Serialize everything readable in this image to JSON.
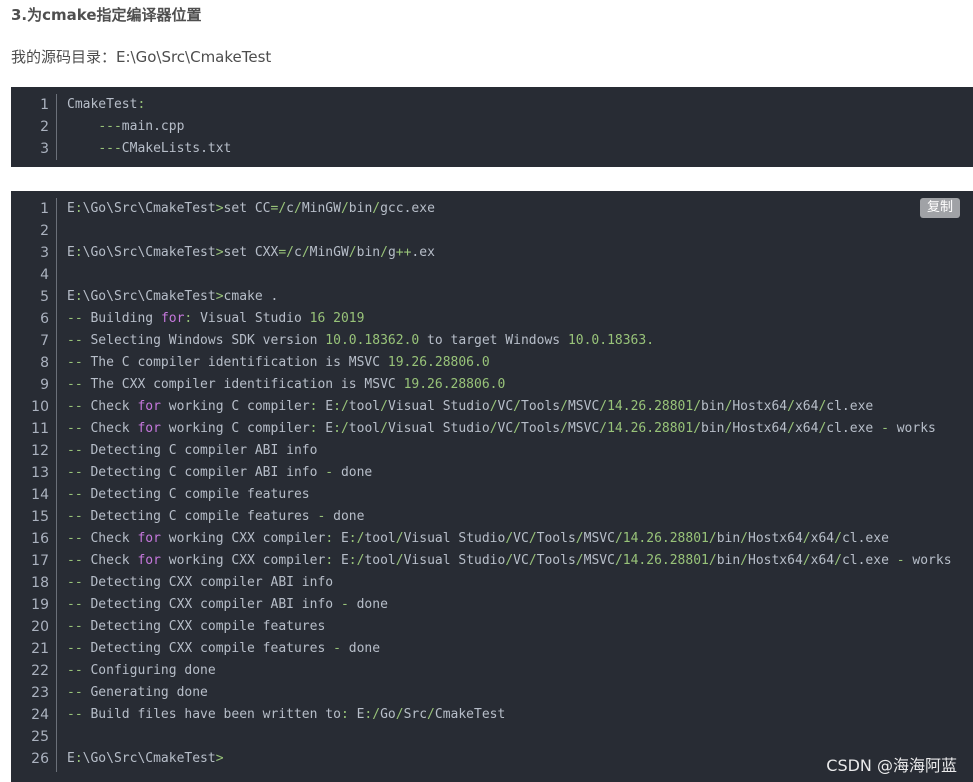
{
  "article": {
    "heading": "3.为cmake指定编译器位置",
    "paragraph": "我的源码目录：E:\\Go\\Src\\CmakeTest"
  },
  "code_block_1": {
    "lines": [
      [
        {
          "t": "CmakeTest"
        },
        {
          "t": ":",
          "c": "p"
        }
      ],
      [
        {
          "t": "    "
        },
        {
          "t": "---",
          "c": "p"
        },
        {
          "t": "main.cpp"
        }
      ],
      [
        {
          "t": "    "
        },
        {
          "t": "---",
          "c": "p"
        },
        {
          "t": "CMakeLists.txt"
        }
      ]
    ]
  },
  "code_block_2": {
    "copy_label": "复制",
    "watermark": "CSDN @海海阿蓝",
    "lines": [
      [
        {
          "t": "E"
        },
        {
          "t": ":",
          "c": "p"
        },
        {
          "t": "\\Go\\Src\\CmakeTest"
        },
        {
          "t": ">",
          "c": "p"
        },
        {
          "t": "set CC"
        },
        {
          "t": "=/",
          "c": "p"
        },
        {
          "t": "c"
        },
        {
          "t": "/",
          "c": "p"
        },
        {
          "t": "MinGW"
        },
        {
          "t": "/",
          "c": "p"
        },
        {
          "t": "bin"
        },
        {
          "t": "/",
          "c": "p"
        },
        {
          "t": "gcc.exe"
        }
      ],
      [],
      [
        {
          "t": "E"
        },
        {
          "t": ":",
          "c": "p"
        },
        {
          "t": "\\Go\\Src\\CmakeTest"
        },
        {
          "t": ">",
          "c": "p"
        },
        {
          "t": "set CXX"
        },
        {
          "t": "=/",
          "c": "p"
        },
        {
          "t": "c"
        },
        {
          "t": "/",
          "c": "p"
        },
        {
          "t": "MinGW"
        },
        {
          "t": "/",
          "c": "p"
        },
        {
          "t": "bin"
        },
        {
          "t": "/",
          "c": "p"
        },
        {
          "t": "g"
        },
        {
          "t": "++",
          "c": "p"
        },
        {
          "t": ".ex"
        }
      ],
      [],
      [
        {
          "t": "E"
        },
        {
          "t": ":",
          "c": "p"
        },
        {
          "t": "\\Go\\Src\\CmakeTest"
        },
        {
          "t": ">",
          "c": "p"
        },
        {
          "t": "cmake ."
        }
      ],
      [
        {
          "t": "--",
          "c": "p"
        },
        {
          "t": " Building "
        },
        {
          "t": "for",
          "c": "k"
        },
        {
          "t": ":",
          "c": "p"
        },
        {
          "t": " Visual Studio "
        },
        {
          "t": "16",
          "c": "n"
        },
        {
          "t": " "
        },
        {
          "t": "2019",
          "c": "n"
        }
      ],
      [
        {
          "t": "--",
          "c": "p"
        },
        {
          "t": " Selecting Windows SDK version "
        },
        {
          "t": "10.0.18362.0",
          "c": "n"
        },
        {
          "t": " to target Windows "
        },
        {
          "t": "10.0.18363",
          "c": "n"
        },
        {
          "t": ".",
          "c": "p"
        }
      ],
      [
        {
          "t": "--",
          "c": "p"
        },
        {
          "t": " The C compiler identification is MSVC "
        },
        {
          "t": "19.26.28806.0",
          "c": "n"
        }
      ],
      [
        {
          "t": "--",
          "c": "p"
        },
        {
          "t": " The CXX compiler identification is MSVC "
        },
        {
          "t": "19.26.28806.0",
          "c": "n"
        }
      ],
      [
        {
          "t": "--",
          "c": "p"
        },
        {
          "t": " Check "
        },
        {
          "t": "for",
          "c": "k"
        },
        {
          "t": " working C compiler"
        },
        {
          "t": ":",
          "c": "p"
        },
        {
          "t": " E"
        },
        {
          "t": ":/",
          "c": "p"
        },
        {
          "t": "tool"
        },
        {
          "t": "/",
          "c": "p"
        },
        {
          "t": "Visual Studio"
        },
        {
          "t": "/",
          "c": "p"
        },
        {
          "t": "VC"
        },
        {
          "t": "/",
          "c": "p"
        },
        {
          "t": "Tools"
        },
        {
          "t": "/",
          "c": "p"
        },
        {
          "t": "MSVC"
        },
        {
          "t": "/",
          "c": "p"
        },
        {
          "t": "14.26.28801",
          "c": "n"
        },
        {
          "t": "/",
          "c": "p"
        },
        {
          "t": "bin"
        },
        {
          "t": "/",
          "c": "p"
        },
        {
          "t": "Hostx64"
        },
        {
          "t": "/",
          "c": "p"
        },
        {
          "t": "x64"
        },
        {
          "t": "/",
          "c": "p"
        },
        {
          "t": "cl.exe"
        }
      ],
      [
        {
          "t": "--",
          "c": "p"
        },
        {
          "t": " Check "
        },
        {
          "t": "for",
          "c": "k"
        },
        {
          "t": " working C compiler"
        },
        {
          "t": ":",
          "c": "p"
        },
        {
          "t": " E"
        },
        {
          "t": ":/",
          "c": "p"
        },
        {
          "t": "tool"
        },
        {
          "t": "/",
          "c": "p"
        },
        {
          "t": "Visual Studio"
        },
        {
          "t": "/",
          "c": "p"
        },
        {
          "t": "VC"
        },
        {
          "t": "/",
          "c": "p"
        },
        {
          "t": "Tools"
        },
        {
          "t": "/",
          "c": "p"
        },
        {
          "t": "MSVC"
        },
        {
          "t": "/",
          "c": "p"
        },
        {
          "t": "14.26.28801",
          "c": "n"
        },
        {
          "t": "/",
          "c": "p"
        },
        {
          "t": "bin"
        },
        {
          "t": "/",
          "c": "p"
        },
        {
          "t": "Hostx64"
        },
        {
          "t": "/",
          "c": "p"
        },
        {
          "t": "x64"
        },
        {
          "t": "/",
          "c": "p"
        },
        {
          "t": "cl.exe "
        },
        {
          "t": "-",
          "c": "p"
        },
        {
          "t": " works"
        }
      ],
      [
        {
          "t": "--",
          "c": "p"
        },
        {
          "t": " Detecting C compiler ABI info"
        }
      ],
      [
        {
          "t": "--",
          "c": "p"
        },
        {
          "t": " Detecting C compiler ABI info "
        },
        {
          "t": "-",
          "c": "p"
        },
        {
          "t": " done"
        }
      ],
      [
        {
          "t": "--",
          "c": "p"
        },
        {
          "t": " Detecting C compile features"
        }
      ],
      [
        {
          "t": "--",
          "c": "p"
        },
        {
          "t": " Detecting C compile features "
        },
        {
          "t": "-",
          "c": "p"
        },
        {
          "t": " done"
        }
      ],
      [
        {
          "t": "--",
          "c": "p"
        },
        {
          "t": " Check "
        },
        {
          "t": "for",
          "c": "k"
        },
        {
          "t": " working CXX compiler"
        },
        {
          "t": ":",
          "c": "p"
        },
        {
          "t": " E"
        },
        {
          "t": ":/",
          "c": "p"
        },
        {
          "t": "tool"
        },
        {
          "t": "/",
          "c": "p"
        },
        {
          "t": "Visual Studio"
        },
        {
          "t": "/",
          "c": "p"
        },
        {
          "t": "VC"
        },
        {
          "t": "/",
          "c": "p"
        },
        {
          "t": "Tools"
        },
        {
          "t": "/",
          "c": "p"
        },
        {
          "t": "MSVC"
        },
        {
          "t": "/",
          "c": "p"
        },
        {
          "t": "14.26.28801",
          "c": "n"
        },
        {
          "t": "/",
          "c": "p"
        },
        {
          "t": "bin"
        },
        {
          "t": "/",
          "c": "p"
        },
        {
          "t": "Hostx64"
        },
        {
          "t": "/",
          "c": "p"
        },
        {
          "t": "x64"
        },
        {
          "t": "/",
          "c": "p"
        },
        {
          "t": "cl.exe"
        }
      ],
      [
        {
          "t": "--",
          "c": "p"
        },
        {
          "t": " Check "
        },
        {
          "t": "for",
          "c": "k"
        },
        {
          "t": " working CXX compiler"
        },
        {
          "t": ":",
          "c": "p"
        },
        {
          "t": " E"
        },
        {
          "t": ":/",
          "c": "p"
        },
        {
          "t": "tool"
        },
        {
          "t": "/",
          "c": "p"
        },
        {
          "t": "Visual Studio"
        },
        {
          "t": "/",
          "c": "p"
        },
        {
          "t": "VC"
        },
        {
          "t": "/",
          "c": "p"
        },
        {
          "t": "Tools"
        },
        {
          "t": "/",
          "c": "p"
        },
        {
          "t": "MSVC"
        },
        {
          "t": "/",
          "c": "p"
        },
        {
          "t": "14.26.28801",
          "c": "n"
        },
        {
          "t": "/",
          "c": "p"
        },
        {
          "t": "bin"
        },
        {
          "t": "/",
          "c": "p"
        },
        {
          "t": "Hostx64"
        },
        {
          "t": "/",
          "c": "p"
        },
        {
          "t": "x64"
        },
        {
          "t": "/",
          "c": "p"
        },
        {
          "t": "cl.exe "
        },
        {
          "t": "-",
          "c": "p"
        },
        {
          "t": " works"
        }
      ],
      [
        {
          "t": "--",
          "c": "p"
        },
        {
          "t": " Detecting CXX compiler ABI info"
        }
      ],
      [
        {
          "t": "--",
          "c": "p"
        },
        {
          "t": " Detecting CXX compiler ABI info "
        },
        {
          "t": "-",
          "c": "p"
        },
        {
          "t": " done"
        }
      ],
      [
        {
          "t": "--",
          "c": "p"
        },
        {
          "t": " Detecting CXX compile features"
        }
      ],
      [
        {
          "t": "--",
          "c": "p"
        },
        {
          "t": " Detecting CXX compile features "
        },
        {
          "t": "-",
          "c": "p"
        },
        {
          "t": " done"
        }
      ],
      [
        {
          "t": "--",
          "c": "p"
        },
        {
          "t": " Configuring done"
        }
      ],
      [
        {
          "t": "--",
          "c": "p"
        },
        {
          "t": " Generating done"
        }
      ],
      [
        {
          "t": "--",
          "c": "p"
        },
        {
          "t": " Build files have been written to"
        },
        {
          "t": ":",
          "c": "p"
        },
        {
          "t": " E"
        },
        {
          "t": ":/",
          "c": "p"
        },
        {
          "t": "Go"
        },
        {
          "t": "/",
          "c": "p"
        },
        {
          "t": "Src"
        },
        {
          "t": "/",
          "c": "p"
        },
        {
          "t": "CmakeTest"
        }
      ],
      [],
      [
        {
          "t": "E"
        },
        {
          "t": ":",
          "c": "p"
        },
        {
          "t": "\\Go\\Src\\CmakeTest"
        },
        {
          "t": ">",
          "c": "p"
        }
      ]
    ]
  }
}
